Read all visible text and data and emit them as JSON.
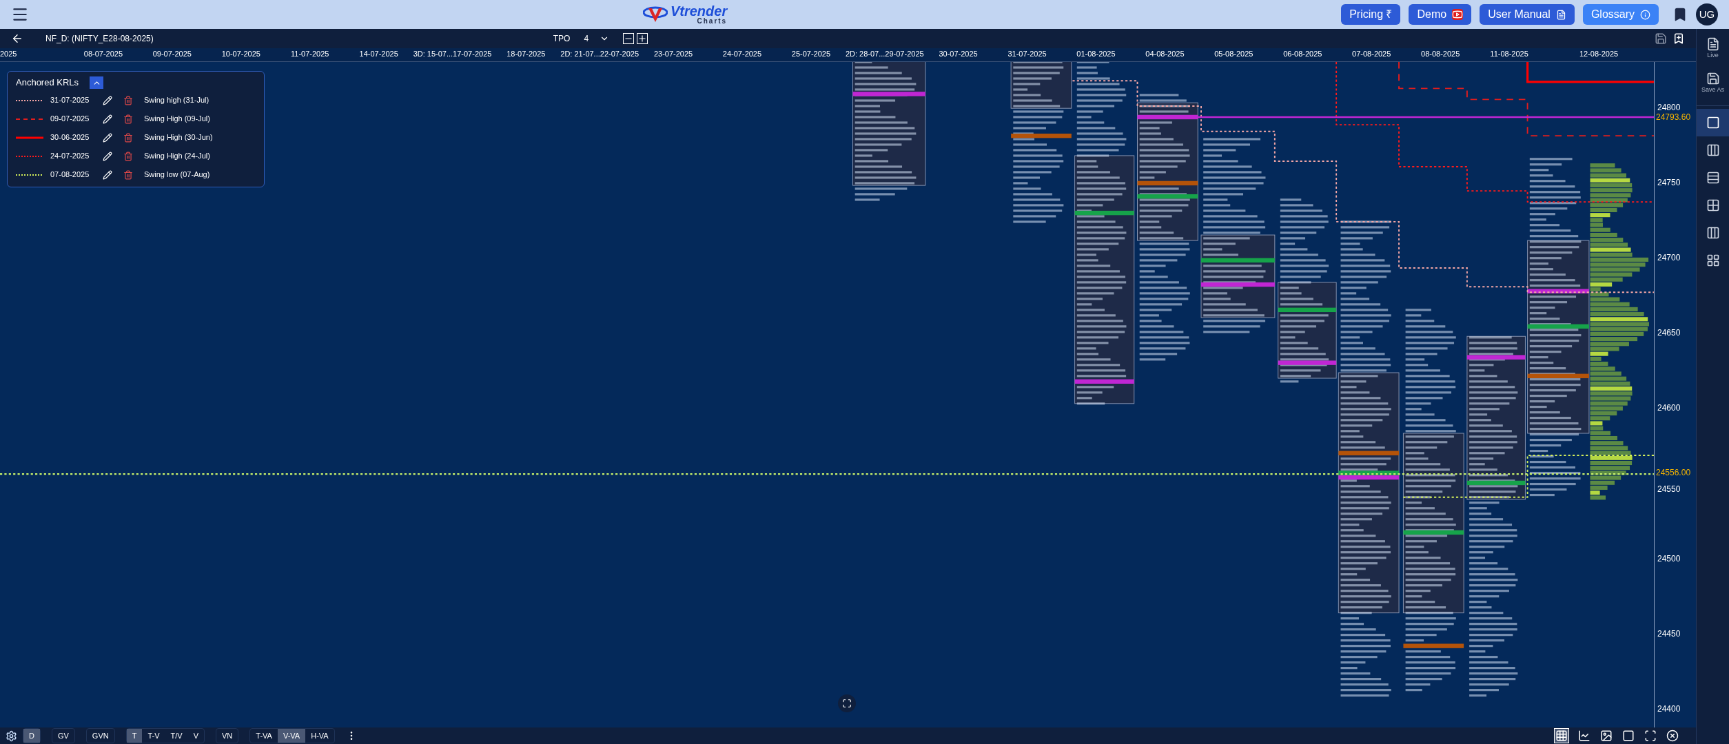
{
  "top_bar": {
    "logo": {
      "name": "Vtrender",
      "tagline": "Charts"
    },
    "buttons": [
      {
        "label": "Pricing ₹",
        "kind": "plain"
      },
      {
        "label": "Demo",
        "kind": "video"
      },
      {
        "label": "User Manual",
        "kind": "doc"
      },
      {
        "label": "Glossary",
        "kind": "info"
      }
    ],
    "avatar": "UG"
  },
  "toolbar": {
    "symbol": "NF_D: (NIFTY_E28-08-2025)",
    "mode": "TPO",
    "tpo_size": "4"
  },
  "date_axis": [
    "2025",
    "08-07-2025",
    "09-07-2025",
    "10-07-2025",
    "11-07-2025",
    "14-07-2025",
    "3D: 15-07...17-07-2025",
    "18-07-2025",
    "2D: 21-07...22-07-2025",
    "23-07-2025",
    "24-07-2025",
    "25-07-2025",
    "2D: 28-07...29-07-2025",
    "30-07-2025",
    "31-07-2025",
    "01-08-2025",
    "04-08-2025",
    "05-08-2025",
    "06-08-2025",
    "07-08-2025",
    "08-08-2025",
    "11-08-2025",
    "12-08-2025"
  ],
  "krl_panel": {
    "title": "Anchored KRLs",
    "expanded": true,
    "rows": [
      {
        "date": "31-07-2025",
        "label": "Swing high (31-Jul)",
        "kind": "dotted",
        "color": "#f4a6a6"
      },
      {
        "date": "09-07-2025",
        "label": "Swing High (09-Jul)",
        "kind": "dashed",
        "color": "#e11d1d"
      },
      {
        "date": "30-06-2025",
        "label": "Swing High (30-Jun)",
        "kind": "solid",
        "color": "#ff0000"
      },
      {
        "date": "24-07-2025",
        "label": "Swing High (24-Jul)",
        "kind": "dotted",
        "color": "#ff1a1a"
      },
      {
        "date": "07-08-2025",
        "label": "Swing low (07-Aug)",
        "kind": "dotted",
        "color": "#d4f05a"
      }
    ]
  },
  "price_axis": {
    "ticks": [
      "24800",
      "24750",
      "24700",
      "24650",
      "24600",
      "24550",
      "24500",
      "24450",
      "24400"
    ],
    "markers": [
      {
        "label": "24793.60"
      },
      {
        "label": "24556.00"
      }
    ]
  },
  "bottom_bar": {
    "groups": [
      {
        "buttons": [
          {
            "label": "D",
            "selected": true
          }
        ]
      },
      {
        "buttons": [
          {
            "label": "GV",
            "selected": false
          }
        ]
      },
      {
        "buttons": [
          {
            "label": "GVN",
            "selected": false
          }
        ]
      },
      {
        "buttons": [
          {
            "label": "T",
            "selected": true
          },
          {
            "label": "T-V",
            "selected": false
          },
          {
            "label": "T/V",
            "selected": false
          },
          {
            "label": "V",
            "selected": false
          }
        ]
      },
      {
        "buttons": [
          {
            "label": "VN",
            "selected": false
          }
        ]
      },
      {
        "buttons": [
          {
            "label": "T-VA",
            "selected": false
          },
          {
            "label": "V-VA",
            "selected": true
          },
          {
            "label": "H-VA",
            "selected": false
          }
        ]
      }
    ],
    "tools": [
      {
        "kind": "grid",
        "selected": true
      },
      {
        "kind": "line",
        "selected": false
      },
      {
        "kind": "image",
        "selected": false
      },
      {
        "kind": "abc",
        "selected": false
      },
      {
        "kind": "focus",
        "selected": false
      },
      {
        "kind": "close",
        "selected": false
      }
    ]
  },
  "sidebar": {
    "actions": [
      {
        "label": "Live",
        "kind": "doc"
      },
      {
        "label": "Save As",
        "kind": "save"
      }
    ],
    "layouts": [
      {
        "kind": "single",
        "selected": true
      },
      {
        "kind": "split",
        "selected": false
      },
      {
        "kind": "rows",
        "selected": false
      },
      {
        "kind": "grid4",
        "selected": false
      },
      {
        "kind": "cols3",
        "selected": false
      },
      {
        "kind": "grid6",
        "selected": false
      }
    ]
  }
}
